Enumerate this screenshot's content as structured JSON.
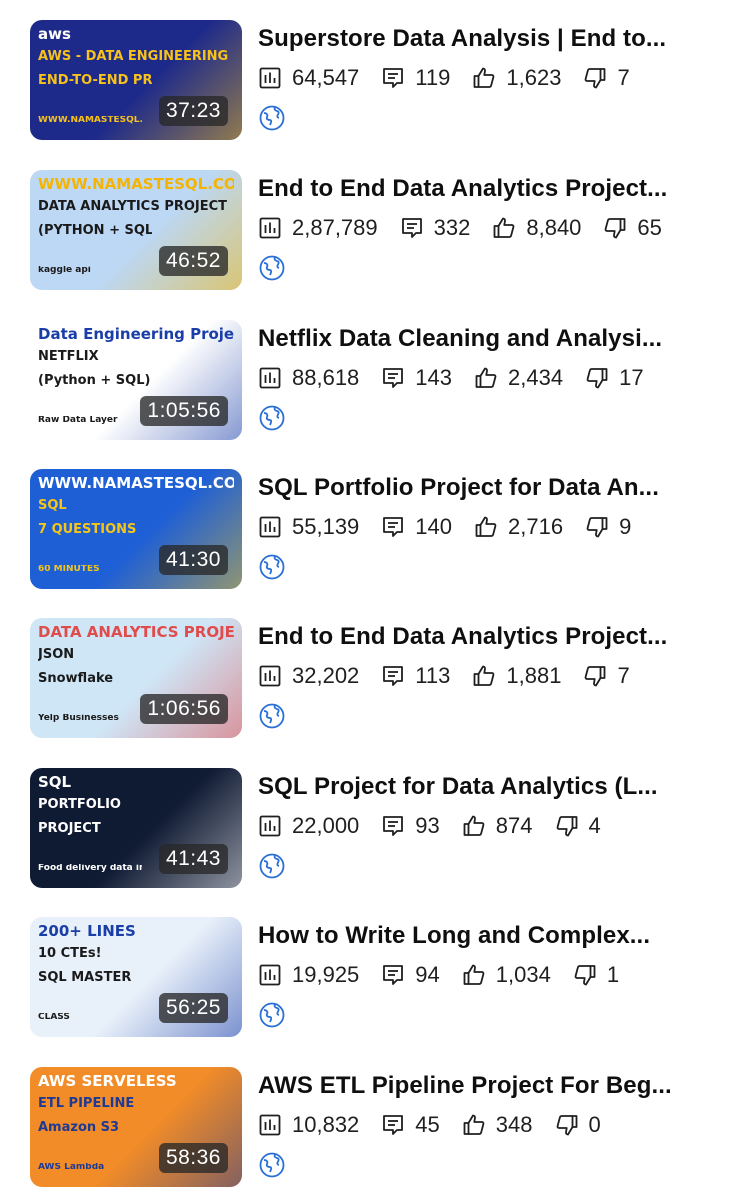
{
  "icons": {
    "views": "bar-chart-icon",
    "comments": "comment-icon",
    "likes": "thumbs-up-icon",
    "dislikes": "thumbs-down-icon",
    "visibility": "globe-icon"
  },
  "videos": [
    {
      "title": "Superstore Data Analysis | End to...",
      "duration": "37:23",
      "views": "64,547",
      "comments": "119",
      "likes": "1,623",
      "dislikes": "7",
      "thumb_text": [
        "aws",
        "AWS - DATA ENGINEERING",
        "END-TO-END PROJECT",
        "WWW.NAMASTESQL.COM"
      ],
      "thumb_bg": "#1e2a8a",
      "thumb_accent": "#f7c21a"
    },
    {
      "title": "End to End Data Analytics Project...",
      "duration": "46:52",
      "views": "2,87,789",
      "comments": "332",
      "likes": "8,840",
      "dislikes": "65",
      "thumb_text": [
        "WWW.NAMASTESQL.COM",
        "DATA ANALYTICS PROJECT",
        "(PYTHON + SQL)",
        "kaggle api"
      ],
      "thumb_bg": "#bcd8f5",
      "thumb_accent": "#f4b400"
    },
    {
      "title": "Netflix Data Cleaning and Analysi...",
      "duration": "1:05:56",
      "views": "88,618",
      "comments": "143",
      "likes": "2,434",
      "dislikes": "17",
      "thumb_text": [
        "Data Engineering Project",
        "NETFLIX",
        "(Python + SQL)",
        "Raw Data Layer"
      ],
      "thumb_bg": "#ffffff",
      "thumb_accent": "#1a3ea8"
    },
    {
      "title": "SQL Portfolio Project for Data An...",
      "duration": "41:30",
      "views": "55,139",
      "comments": "140",
      "likes": "2,716",
      "dislikes": "9",
      "thumb_text": [
        "WWW.NAMASTESQL.COM",
        "SQL",
        "7 QUESTIONS",
        "60 MINUTES"
      ],
      "thumb_bg": "#1e5fd6",
      "thumb_accent": "#f5c518"
    },
    {
      "title": "End to End Data Analytics Project...",
      "duration": "1:06:56",
      "views": "32,202",
      "comments": "113",
      "likes": "1,881",
      "dislikes": "7",
      "thumb_text": [
        "DATA ANALYTICS PROJECT",
        "JSON",
        "Snowflake",
        "Yelp Businesses"
      ],
      "thumb_bg": "#cfe6f7",
      "thumb_accent": "#e04b4b"
    },
    {
      "title": "SQL Project for Data Analytics (L...",
      "duration": "41:43",
      "views": "22,000",
      "comments": "93",
      "likes": "874",
      "dislikes": "4",
      "thumb_text": [
        "SQL",
        "PORTFOLIO",
        "PROJECT",
        "Food delivery data insights"
      ],
      "thumb_bg": "#0f1a33",
      "thumb_accent": "#ffffff"
    },
    {
      "title": "How to Write Long and Complex...",
      "duration": "56:25",
      "views": "19,925",
      "comments": "94",
      "likes": "1,034",
      "dislikes": "1",
      "thumb_text": [
        "200+ LINES",
        "10 CTEs!",
        "SQL MASTER",
        "CLASS"
      ],
      "thumb_bg": "#e8f0fa",
      "thumb_accent": "#1a3ea8"
    },
    {
      "title": "AWS ETL Pipeline Project For Beg...",
      "duration": "58:36",
      "views": "10,832",
      "comments": "45",
      "likes": "348",
      "dislikes": "0",
      "thumb_text": [
        "AWS SERVELESS",
        "ETL PIPELINE",
        "Amazon S3",
        "AWS Lambda"
      ],
      "thumb_bg": "#f28c28",
      "thumb_accent": "#1f3a93"
    }
  ]
}
